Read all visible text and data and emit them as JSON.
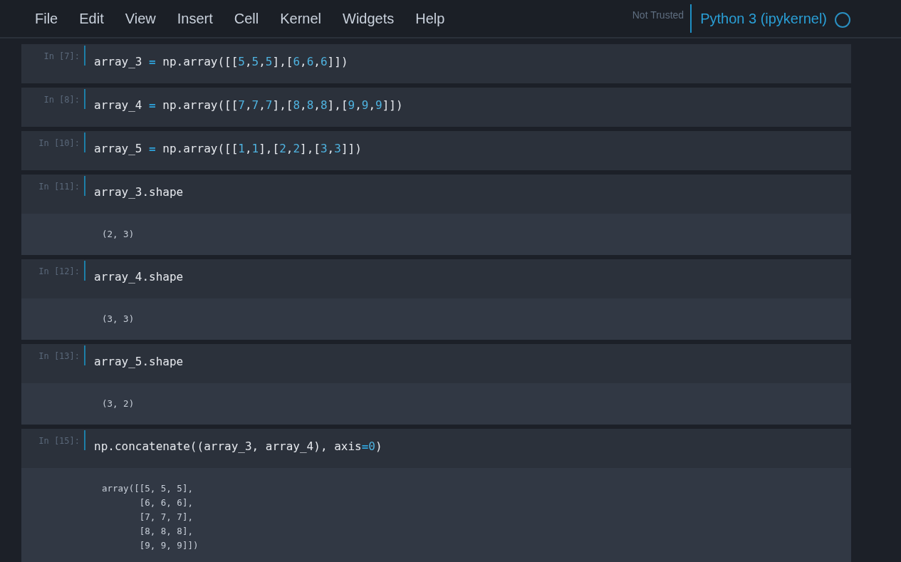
{
  "menu": [
    "File",
    "Edit",
    "View",
    "Insert",
    "Cell",
    "Kernel",
    "Widgets",
    "Help"
  ],
  "trust_status": "Not Trusted",
  "kernel_name": "Python 3 (ipykernel)",
  "cells": [
    {
      "prompt": "In [7]:",
      "code": [
        {
          "kind": "plain",
          "text": "array_3 "
        },
        {
          "kind": "operator",
          "text": "="
        },
        {
          "kind": "plain",
          "text": " np.array([["
        },
        {
          "kind": "number",
          "text": "5"
        },
        {
          "kind": "plain",
          "text": ","
        },
        {
          "kind": "number",
          "text": "5"
        },
        {
          "kind": "plain",
          "text": ","
        },
        {
          "kind": "number",
          "text": "5"
        },
        {
          "kind": "plain",
          "text": "],["
        },
        {
          "kind": "number",
          "text": "6"
        },
        {
          "kind": "plain",
          "text": ","
        },
        {
          "kind": "number",
          "text": "6"
        },
        {
          "kind": "plain",
          "text": ","
        },
        {
          "kind": "number",
          "text": "6"
        },
        {
          "kind": "plain",
          "text": "]])"
        }
      ]
    },
    {
      "prompt": "In [8]:",
      "code": [
        {
          "kind": "plain",
          "text": "array_4 "
        },
        {
          "kind": "operator",
          "text": "="
        },
        {
          "kind": "plain",
          "text": " np.array([["
        },
        {
          "kind": "number",
          "text": "7"
        },
        {
          "kind": "plain",
          "text": ","
        },
        {
          "kind": "number",
          "text": "7"
        },
        {
          "kind": "plain",
          "text": ","
        },
        {
          "kind": "number",
          "text": "7"
        },
        {
          "kind": "plain",
          "text": "],["
        },
        {
          "kind": "number",
          "text": "8"
        },
        {
          "kind": "plain",
          "text": ","
        },
        {
          "kind": "number",
          "text": "8"
        },
        {
          "kind": "plain",
          "text": ","
        },
        {
          "kind": "number",
          "text": "8"
        },
        {
          "kind": "plain",
          "text": "],["
        },
        {
          "kind": "number",
          "text": "9"
        },
        {
          "kind": "plain",
          "text": ","
        },
        {
          "kind": "number",
          "text": "9"
        },
        {
          "kind": "plain",
          "text": ","
        },
        {
          "kind": "number",
          "text": "9"
        },
        {
          "kind": "plain",
          "text": "]])"
        }
      ]
    },
    {
      "prompt": "In [10]:",
      "code": [
        {
          "kind": "plain",
          "text": "array_5 "
        },
        {
          "kind": "operator",
          "text": "="
        },
        {
          "kind": "plain",
          "text": " np.array([["
        },
        {
          "kind": "number",
          "text": "1"
        },
        {
          "kind": "plain",
          "text": ","
        },
        {
          "kind": "number",
          "text": "1"
        },
        {
          "kind": "plain",
          "text": "],["
        },
        {
          "kind": "number",
          "text": "2"
        },
        {
          "kind": "plain",
          "text": ","
        },
        {
          "kind": "number",
          "text": "2"
        },
        {
          "kind": "plain",
          "text": "],["
        },
        {
          "kind": "number",
          "text": "3"
        },
        {
          "kind": "plain",
          "text": ","
        },
        {
          "kind": "number",
          "text": "3"
        },
        {
          "kind": "plain",
          "text": "]])"
        }
      ]
    },
    {
      "prompt": "In [11]:",
      "code": [
        {
          "kind": "plain",
          "text": "array_3.shape"
        }
      ],
      "output": "(2, 3)"
    },
    {
      "prompt": "In [12]:",
      "code": [
        {
          "kind": "plain",
          "text": "array_4.shape"
        }
      ],
      "output": "(3, 3)"
    },
    {
      "prompt": "In [13]:",
      "code": [
        {
          "kind": "plain",
          "text": "array_5.shape"
        }
      ],
      "output": "(3, 2)"
    },
    {
      "prompt": "In [15]:",
      "code": [
        {
          "kind": "plain",
          "text": "np.concatenate((array_3, array_4), axis"
        },
        {
          "kind": "operator",
          "text": "="
        },
        {
          "kind": "number",
          "text": "0"
        },
        {
          "kind": "plain",
          "text": ")"
        }
      ],
      "output": "array([[5, 5, 5],\n       [6, 6, 6],\n       [7, 7, 7],\n       [8, 8, 8],\n       [9, 9, 9]])"
    }
  ]
}
